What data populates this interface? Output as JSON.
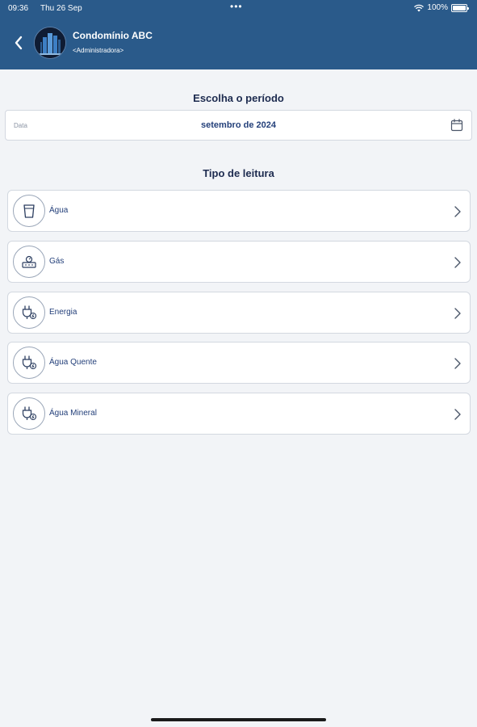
{
  "status_bar": {
    "time": "09:36",
    "date": "Thu 26 Sep",
    "dots": "•••",
    "battery": "100%"
  },
  "header": {
    "title": "Condomínio ABC",
    "subtitle": "<Administradora>"
  },
  "period": {
    "title": "Escolha o período",
    "field_label": "Data",
    "value": "setembro de 2024"
  },
  "reading": {
    "title": "Tipo de leitura",
    "items": [
      {
        "label": "Água",
        "icon": "water-glass-icon"
      },
      {
        "label": "Gás",
        "icon": "gas-meter-icon"
      },
      {
        "label": "Energia",
        "icon": "energy-plug-icon"
      },
      {
        "label": "Água Quente",
        "icon": "hot-water-plug-icon"
      },
      {
        "label": "Água Mineral",
        "icon": "mineral-water-plug-icon"
      }
    ]
  },
  "colors": {
    "header_bg": "#2a5a8a",
    "page_bg": "#f2f4f7",
    "text_primary": "#1d2b4f",
    "accent_text": "#24407a"
  }
}
